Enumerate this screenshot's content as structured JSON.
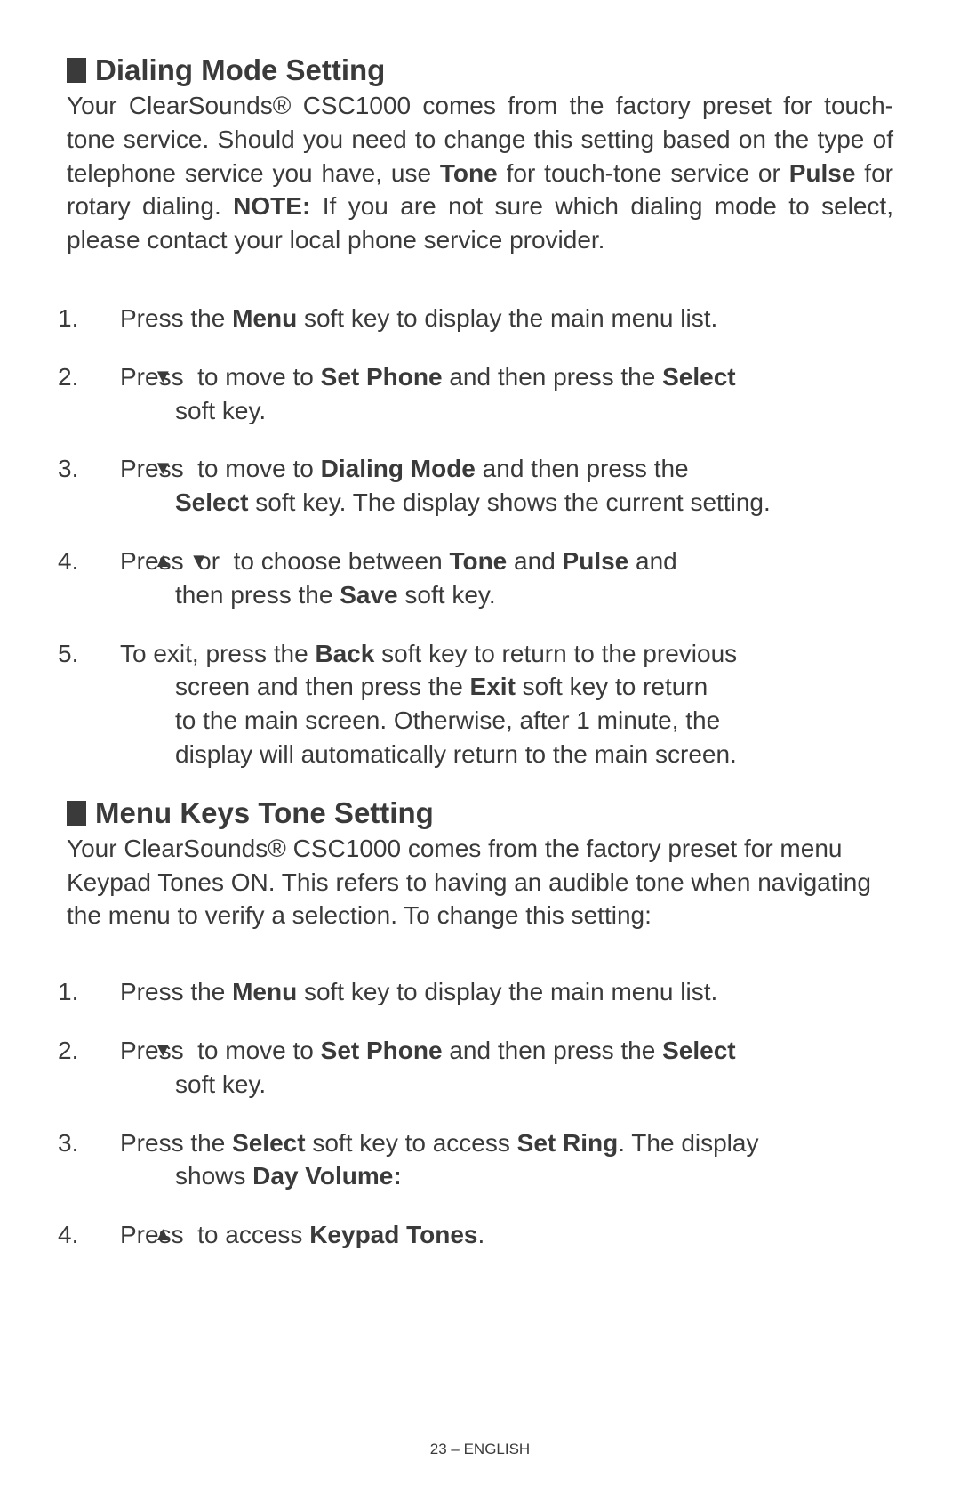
{
  "section1": {
    "heading": "Dialing Mode Setting",
    "intro_part1": "Your ClearSounds® CSC1000 comes from the factory preset for touch-tone service. Should you need to change this setting based on the type of telephone service you have, use ",
    "intro_tone": "Tone",
    "intro_part2": " for touch-tone service or ",
    "intro_pulse": "Pulse",
    "intro_part3": " for rotary dialing.  ",
    "intro_note_label": "NOTE:",
    "intro_part4": " If you are not sure which dialing mode to select, please contact your local phone service provider.",
    "steps": [
      {
        "num": "1.",
        "text_a": "Press the ",
        "bold_a": "Menu",
        "text_b": " soft key to display the main menu list."
      },
      {
        "num": "2.",
        "text_a": "Press ",
        "arrow": "▼",
        "text_b": " to move to ",
        "bold_a": "Set Phone",
        "text_c": " and then press the ",
        "bold_b": "Select",
        "cont": "soft key."
      },
      {
        "num": "3.",
        "text_a": "Press ",
        "arrow": "▼",
        "text_b": " to move to ",
        "bold_a": "Dialing Mode",
        "text_c": " and then press the",
        "cont_bold": "Select",
        "cont_text": " soft key. The display shows the current setting."
      },
      {
        "num": "4.",
        "text_a": "Press ",
        "arrow_up": "▲",
        "text_b": " or ",
        "arrow_down": "▼",
        "text_c": " to choose between ",
        "bold_a": "Tone",
        "text_d": " and ",
        "bold_b": "Pulse",
        "text_e": " and",
        "cont_a": "then press the ",
        "cont_bold": "Save",
        "cont_b": " soft key."
      },
      {
        "num": "5.",
        "text_a": "To exit, press the ",
        "bold_a": "Back",
        "text_b": " soft key to return to the previous",
        "cont1_a": "screen and then press the ",
        "cont1_bold": "Exit",
        "cont1_b": " soft key to return",
        "cont2": "to the main screen.  Otherwise, after 1 minute, the",
        "cont3": "display will automatically return to the main screen."
      }
    ]
  },
  "section2": {
    "heading": "Menu Keys Tone Setting",
    "intro": "Your ClearSounds® CSC1000 comes from the factory preset for menu Keypad Tones ON.  This refers to having an audible tone when navigating the menu to verify a selection. To change this setting:",
    "steps": [
      {
        "num": "1.",
        "text_a": "Press the ",
        "bold_a": "Menu",
        "text_b": " soft key to display the main menu list."
      },
      {
        "num": "2.",
        "text_a": "Press ",
        "arrow": "▼",
        "text_b": " to move to ",
        "bold_a": "Set Phone",
        "text_c": " and then press the ",
        "bold_b": "Select",
        "cont": "soft key."
      },
      {
        "num": "3.",
        "text_a": "Press the ",
        "bold_a": "Select",
        "text_b": " soft key to access ",
        "bold_b": "Set Ring",
        "text_c": ".  The display",
        "cont_a": "shows ",
        "cont_bold": "Day Volume:"
      },
      {
        "num": "4.",
        "text_a": "Press ",
        "arrow_up": "▲",
        "text_b": " to access ",
        "bold_a": "Keypad Tones",
        "text_c": "."
      }
    ]
  },
  "footer": "23 – ENGLISH"
}
